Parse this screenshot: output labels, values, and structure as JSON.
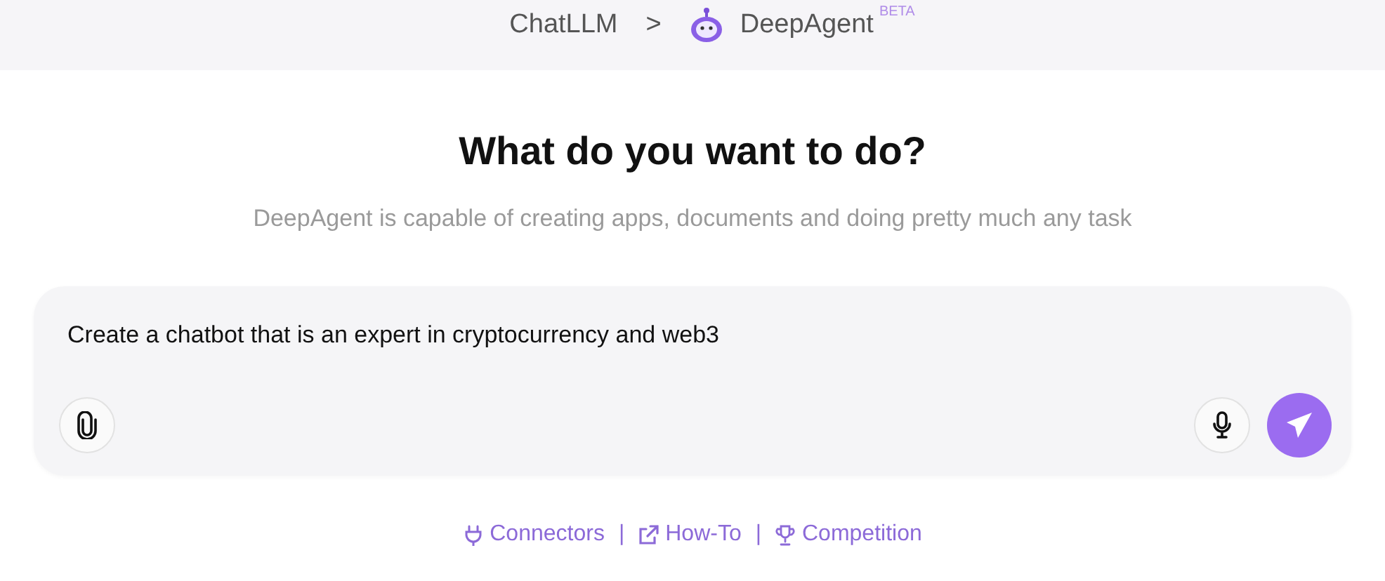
{
  "breadcrumb": {
    "items": [
      {
        "label": "ChatLLM",
        "kind": "text"
      },
      {
        "label": "DeepAgent",
        "kind": "agent"
      }
    ],
    "separator": ">",
    "badge": "BETA"
  },
  "heading": "What do you want to do?",
  "subtitle": "DeepAgent is capable of creating apps, documents and doing pretty much any task",
  "prompt": {
    "value": "Create a chatbot that is an expert in cryptocurrency and web3"
  },
  "links": [
    {
      "label": "Connectors",
      "kind": "plug"
    },
    {
      "label": "How-To",
      "kind": "external"
    },
    {
      "label": "Competition",
      "kind": "trophy"
    }
  ],
  "link_separators": [
    "|",
    "|"
  ]
}
